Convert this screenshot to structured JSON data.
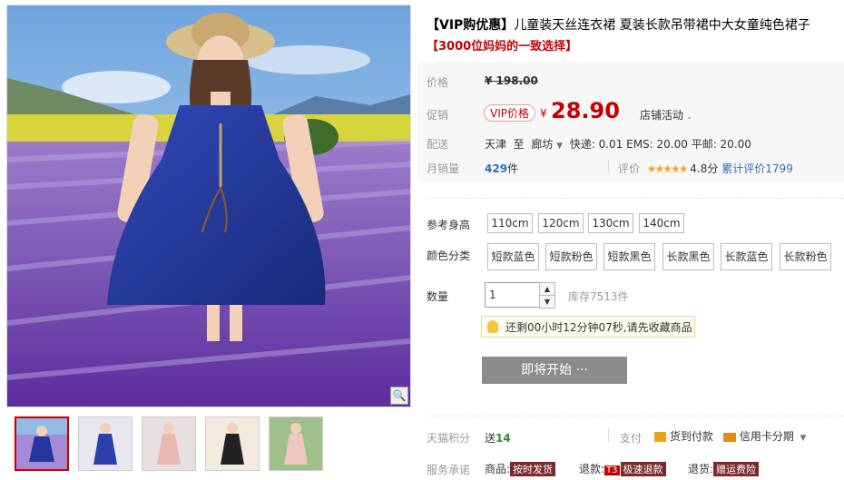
{
  "product": {
    "title_prefix": "【VIP购优惠】",
    "title": "儿童装天丝连衣裙 夏装长款吊带裙中大女童纯色裙子",
    "subtitle": "【3000位妈妈的一致选择】"
  },
  "price": {
    "label": "价格",
    "original": "¥ 198.00",
    "promo_label": "促销",
    "vip_badge": "VIP价格",
    "currency": "¥",
    "current": "28.90",
    "activity": "店铺活动"
  },
  "shipping": {
    "label": "配送",
    "from": "天津",
    "to_word": "至",
    "dest": "廊坊",
    "fees": "快递: 0.01 EMS: 20.00 平邮: 20.00"
  },
  "sales": {
    "label": "月销量",
    "count": "429",
    "unit": "件",
    "rating_label": "评价",
    "stars": "★★★★★",
    "score": "4.8分",
    "total_reviews": "累计评价1799"
  },
  "size": {
    "label": "参考身高",
    "options": [
      "110cm",
      "120cm",
      "130cm",
      "140cm"
    ]
  },
  "color": {
    "label": "颜色分类",
    "options": [
      "短款蓝色",
      "短款粉色",
      "短款黑色",
      "长款黑色",
      "长款蓝色",
      "长款粉色"
    ]
  },
  "quantity": {
    "label": "数量",
    "value": "1",
    "stock": "库存7513件"
  },
  "notice": "还剩00小时12分钟07秒,请先收藏商品",
  "cta": "即将开始 ···",
  "points": {
    "label": "天猫积分",
    "give": "送",
    "value": "14"
  },
  "payment": {
    "label": "支付",
    "cod": "货到付款",
    "installment": "信用卡分期"
  },
  "service": {
    "label": "服务承诺",
    "goods": "商品:",
    "goods_tag": "按时发货",
    "refund": "退款:",
    "refund_t3": "T3",
    "refund_tag": "极速退款",
    "return": "退货:",
    "return_tag": "赠运费险"
  },
  "icons": {
    "zoom": "zoom-icon",
    "bulb": "bulb-icon"
  },
  "colors": {
    "accent": "#c40000",
    "cta": "#8c8c8c"
  }
}
